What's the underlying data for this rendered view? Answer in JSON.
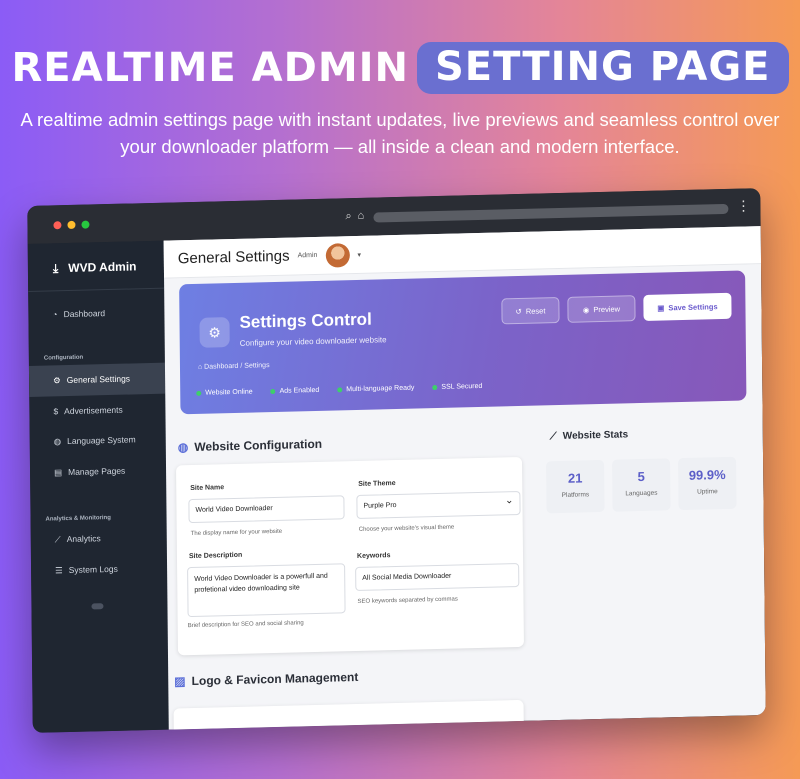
{
  "hero": {
    "title_plain": "REALTIME ADMIN",
    "title_highlight": "SETTING PAGE",
    "subtitle": "A realtime admin settings page with instant updates, live previews and seamless control over your downloader platform — all inside a clean and modern interface."
  },
  "sidebar": {
    "brand": "WVD Admin",
    "dashboard": "Dashboard",
    "section_config": "Configuration",
    "items_config": [
      "General Settings",
      "Advertisements",
      "Language System",
      "Manage Pages"
    ],
    "section_analytics": "Analytics & Monitoring",
    "items_analytics": [
      "Analytics",
      "System Logs"
    ]
  },
  "header": {
    "title": "General Settings",
    "user": "Admin"
  },
  "banner": {
    "title": "Settings Control",
    "subtitle": "Configure your video downloader website",
    "breadcrumb": [
      "Dashboard",
      "Settings"
    ],
    "buttons": {
      "reset": "Reset",
      "preview": "Preview",
      "save": "Save Settings"
    },
    "badges": [
      "Website Online",
      "Ads Enabled",
      "Multi-language Ready",
      "SSL Secured"
    ]
  },
  "config": {
    "title": "Website Configuration",
    "site_name": {
      "label": "Site Name",
      "value": "World Video Downloader",
      "hint": "The display name for your website"
    },
    "site_theme": {
      "label": "Site Theme",
      "value": "Purple Pro",
      "hint": "Choose your website's visual theme"
    },
    "site_description": {
      "label": "Site Description",
      "value": "World Video Downloader is a powerfull and profetional video downloading site",
      "hint": "Brief description for SEO and social sharing"
    },
    "keywords": {
      "label": "Keywords",
      "value": "All Social Media Downloader",
      "hint": "SEO keywords separated by commas"
    }
  },
  "stats": {
    "title": "Website Stats",
    "items": [
      {
        "value": "21",
        "label": "Platforms"
      },
      {
        "value": "5",
        "label": "Languages"
      },
      {
        "value": "99.9%",
        "label": "Uptime"
      }
    ]
  },
  "logo": {
    "title": "Logo & Favicon Management"
  },
  "colors": {
    "accent": "#6a5acd",
    "sidebar": "#1f2631",
    "success": "#3ecf6b"
  }
}
